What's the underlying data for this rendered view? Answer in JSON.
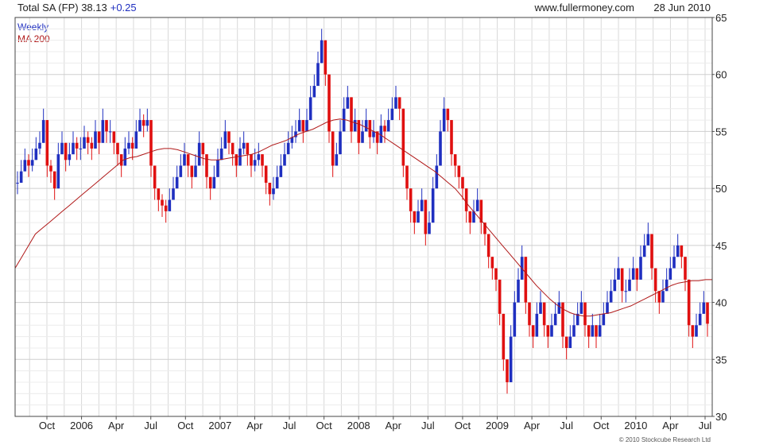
{
  "header": {
    "title": "Total SA (FP) 38.13",
    "change": "+0.25",
    "site": "www.fullermoney.com",
    "date": "28 Jun 2010"
  },
  "legend": [
    {
      "label": "Weekly",
      "color": "#1f2fc0"
    },
    {
      "label": "MA 200",
      "color": "#b01818"
    }
  ],
  "copyright": "© 2010 Stockcube Research Ltd",
  "colors": {
    "up": "#1f2fc0",
    "down": "#e01010",
    "ma": "#b01818",
    "grid": "#d8d8d8"
  },
  "chart_data": {
    "type": "line",
    "x_tick_labels": [
      "Oct",
      "2006",
      "Apr",
      "Jul",
      "Oct",
      "2007",
      "Apr",
      "Jul",
      "Oct",
      "2008",
      "Apr",
      "Jul",
      "Oct",
      "2009",
      "Apr",
      "Jul",
      "Oct",
      "2010",
      "Apr",
      "Jul"
    ],
    "y_ticks": [
      30,
      35,
      40,
      45,
      50,
      55,
      60,
      65
    ],
    "ylim": [
      30,
      65
    ],
    "y_axis_side": "right",
    "grid": true,
    "legend_position": "top-left",
    "series": [
      {
        "name": "Weekly",
        "style": "candlestick",
        "interval": "weekly",
        "close": [
          50.5,
          51.5,
          52.5,
          52,
          52.5,
          53.5,
          54,
          56,
          52,
          51.5,
          50,
          53,
          54,
          52.5,
          53,
          54,
          53.5,
          53.5,
          54.5,
          54,
          53.5,
          55,
          54,
          56,
          55,
          55,
          54,
          53,
          52,
          53.5,
          54,
          53.5,
          55,
          56,
          55.5,
          56,
          52,
          50,
          49,
          48.5,
          48,
          49,
          50,
          51,
          52,
          53,
          52,
          51,
          52,
          54,
          53,
          51,
          50,
          51,
          52.5,
          53.5,
          55,
          54,
          53,
          52,
          53.5,
          54,
          53,
          52,
          52.5,
          53,
          52,
          50.5,
          49.5,
          50,
          51,
          52,
          53,
          54,
          54.5,
          55,
          56,
          55,
          56,
          58,
          59,
          61,
          63,
          60,
          55,
          52,
          53,
          55,
          57,
          58,
          55,
          56,
          54,
          55,
          56,
          54.5,
          55,
          54,
          55.5,
          55,
          56,
          57,
          58,
          57,
          52,
          50,
          48,
          47,
          48,
          49,
          46,
          47,
          50,
          52,
          55,
          57,
          56,
          53,
          52,
          51,
          50,
          48,
          47,
          48,
          49,
          47,
          46,
          44,
          43,
          42,
          39,
          35,
          33,
          37,
          40,
          42,
          44,
          40,
          38,
          37,
          39,
          40,
          38,
          37,
          38,
          39,
          40,
          37,
          36,
          37,
          38,
          39,
          40,
          38,
          37,
          38,
          37,
          38,
          39,
          40,
          41,
          42,
          43,
          41,
          41,
          42,
          43,
          42,
          44,
          45,
          46,
          43,
          41,
          40,
          41,
          42,
          43,
          44,
          45,
          44,
          42,
          38,
          37,
          38,
          39,
          40,
          38.13
        ],
        "high": [
          51.5,
          52.5,
          53.5,
          53,
          53.5,
          54.5,
          55,
          57,
          53,
          52.5,
          51,
          54,
          55,
          53.5,
          54,
          55,
          54.5,
          54.5,
          55.5,
          55,
          54.5,
          56,
          55,
          57,
          56,
          56,
          55,
          54,
          53,
          54.5,
          55,
          54.5,
          56,
          57,
          56.5,
          57,
          53,
          51,
          50,
          49.5,
          49,
          50,
          51,
          52,
          53,
          54,
          53,
          52,
          53,
          55,
          54,
          52,
          51,
          52,
          53.5,
          54.5,
          56,
          55,
          54,
          53,
          54.5,
          55,
          54,
          53,
          53.5,
          54,
          53,
          51.5,
          50.5,
          51,
          52,
          53,
          54,
          55,
          55.5,
          56,
          57,
          56,
          57,
          59,
          60,
          62,
          64,
          61,
          56,
          53,
          54,
          56,
          58,
          59,
          56,
          57,
          55,
          56,
          57,
          55.5,
          56,
          55,
          56.5,
          56,
          57,
          58,
          59,
          58,
          53,
          51,
          49,
          48,
          49,
          50,
          47,
          48,
          51,
          53,
          56,
          58,
          57,
          54,
          53,
          52,
          51,
          49,
          48,
          49,
          50,
          48,
          47,
          45,
          44,
          43,
          40,
          36,
          34,
          38,
          41,
          43,
          45,
          41,
          39,
          38,
          40,
          41,
          39,
          38,
          39,
          40,
          41,
          38,
          37,
          38,
          39,
          40,
          41,
          39,
          38,
          39,
          38,
          39,
          40,
          41,
          42,
          43,
          44,
          42,
          42,
          43,
          44,
          43,
          45,
          46,
          47,
          44,
          42,
          41,
          42,
          43,
          44,
          45,
          46,
          45,
          43,
          39,
          38,
          39,
          40,
          41,
          39
        ],
        "low": [
          49.5,
          50.5,
          51.5,
          51,
          51.5,
          52.5,
          53,
          55,
          51,
          50.5,
          49,
          52,
          53,
          51.5,
          52,
          53,
          52.5,
          52.5,
          53.5,
          53,
          52.5,
          54,
          53,
          55,
          54,
          54,
          53,
          52,
          51,
          52.5,
          53,
          52.5,
          54,
          55,
          54.5,
          55,
          51,
          49,
          48,
          47.5,
          47,
          48,
          49,
          50,
          51,
          52,
          51,
          50,
          51,
          53,
          52,
          50,
          49,
          50,
          51.5,
          52.5,
          54,
          53,
          52,
          51,
          52.5,
          53,
          52,
          51,
          51.5,
          52,
          51,
          49.5,
          48.5,
          49,
          50,
          51,
          52,
          53,
          53.5,
          54,
          55,
          54,
          55,
          57,
          58,
          60,
          62,
          59,
          54,
          51,
          52,
          54,
          56,
          57,
          54,
          55,
          53,
          54,
          55,
          53.5,
          54,
          53,
          54.5,
          54,
          55,
          56,
          57,
          56,
          51,
          49,
          47,
          46,
          47,
          48,
          45,
          46,
          49,
          51,
          54,
          56,
          55,
          52,
          51,
          50,
          49,
          47,
          46,
          47,
          48,
          46,
          45,
          43,
          42,
          41,
          38,
          34,
          32,
          36,
          39,
          41,
          43,
          39,
          37,
          36,
          38,
          39,
          37,
          36,
          37,
          38,
          39,
          36,
          35,
          36,
          37,
          38,
          39,
          37,
          36,
          37,
          36,
          37,
          38,
          39,
          40,
          41,
          42,
          40,
          40,
          41,
          42,
          41,
          43,
          44,
          45,
          42,
          40,
          39,
          40,
          41,
          42,
          43,
          44,
          43,
          41,
          37,
          36,
          37,
          38,
          39,
          37
        ]
      },
      {
        "name": "MA 200",
        "style": "line",
        "values": [
          43,
          44,
          45,
          46,
          46.5,
          47,
          47.5,
          48,
          48.5,
          49,
          49.5,
          50,
          50.5,
          51,
          51.5,
          52,
          52.5,
          52.7,
          52.8,
          53,
          53.2,
          53.4,
          53.5,
          53.5,
          53.4,
          53.2,
          53,
          52.8,
          52.6,
          52.5,
          52.5,
          52.6,
          52.7,
          52.8,
          52.9,
          53,
          53.2,
          53.5,
          53.8,
          54,
          54.2,
          54.5,
          54.8,
          55,
          55.2,
          55.5,
          55.8,
          56,
          56.1,
          56,
          55.8,
          55.6,
          55.3,
          55,
          54.7,
          54.3,
          53.9,
          53.5,
          53.1,
          52.7,
          52.3,
          51.9,
          51.5,
          51,
          50.5,
          50,
          49.3,
          48.5,
          47.8,
          47.1,
          46.4,
          45.7,
          45,
          44.3,
          43.6,
          42.9,
          42.2,
          41.5,
          40.9,
          40.3,
          39.8,
          39.4,
          39.1,
          38.9,
          38.8,
          38.8,
          38.9,
          39,
          39.1,
          39.3,
          39.5,
          39.7,
          40,
          40.3,
          40.6,
          40.9,
          41.2,
          41.5,
          41.7,
          41.8,
          41.9,
          41.9,
          42,
          42
        ]
      }
    ]
  }
}
